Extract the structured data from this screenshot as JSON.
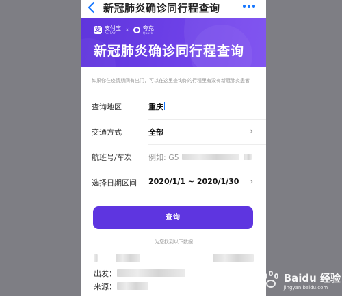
{
  "navbar": {
    "back_icon": "chevron-left-icon",
    "title": "新冠肺炎确诊同行程查询",
    "more_icon": "more-dots-icon"
  },
  "banner": {
    "alipay_name": "支付宝",
    "alipay_sub": "ALIPAY",
    "separator": "×",
    "quark_name": "夸克",
    "quark_sub": "Quark",
    "title": "新冠肺炎确诊同行程查询",
    "color": "#5f35dc"
  },
  "description": "如果你在疫情期间有出门，可以在这里查询你的行程里有没有新冠肺炎患者",
  "form": {
    "region": {
      "label": "查询地区",
      "value": "重庆"
    },
    "transport": {
      "label": "交通方式",
      "value": "全部",
      "icon": "chevron-right-icon"
    },
    "flight": {
      "label": "航班号/车次",
      "placeholder": "例如: G5"
    },
    "date_range": {
      "label": "选择日期区间",
      "value": "2020/1/1 ~ 2020/1/30",
      "icon": "chevron-right-icon"
    }
  },
  "search_button": {
    "label": "查询",
    "color": "#5e35e0"
  },
  "results": {
    "header": "为您找到以下数据",
    "depart_label": "出发：",
    "source_label": "来源："
  },
  "watermark": {
    "text": "Baidu 经验",
    "sub": "jingyan.baidu.com"
  }
}
